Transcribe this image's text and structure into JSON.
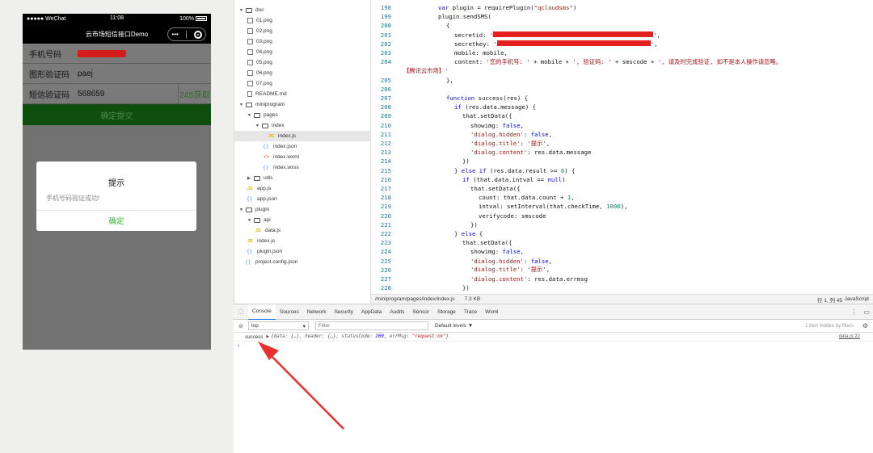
{
  "phone": {
    "carrier": "●●●●● WeChat",
    "time": "11:08",
    "battery": "100%",
    "nav_title": "云市场短信接口Demo",
    "capsule_more": "•••",
    "rows": [
      {
        "label": "手机号码",
        "value": ""
      },
      {
        "label": "图形验证码",
        "value": "paej"
      },
      {
        "label": "短信验证码",
        "value": "568659",
        "action": "24S获取"
      }
    ],
    "submit": "确定提交",
    "dialog": {
      "title": "提示",
      "content": "手机号码验证成功!",
      "confirm": "确定"
    }
  },
  "tree": {
    "items": [
      {
        "label": "doc",
        "kind": "folder",
        "open": true,
        "depth": 0
      },
      {
        "label": "01.png",
        "kind": "img",
        "depth": 1
      },
      {
        "label": "02.png",
        "kind": "img",
        "depth": 1
      },
      {
        "label": "03.png",
        "kind": "img",
        "depth": 1
      },
      {
        "label": "04.png",
        "kind": "img",
        "depth": 1
      },
      {
        "label": "05.png",
        "kind": "img",
        "depth": 1
      },
      {
        "label": "06.png",
        "kind": "img",
        "depth": 1
      },
      {
        "label": "07.png",
        "kind": "img",
        "depth": 1
      },
      {
        "label": "README.md",
        "kind": "doc",
        "depth": 1
      },
      {
        "label": "miniprogram",
        "kind": "folder",
        "open": true,
        "depth": 0
      },
      {
        "label": "pages",
        "kind": "folder",
        "open": true,
        "depth": 1
      },
      {
        "label": "index",
        "kind": "folder",
        "open": true,
        "depth": 2
      },
      {
        "label": "index.js",
        "kind": "js",
        "depth": 3,
        "selected": true
      },
      {
        "label": "index.json",
        "kind": "json",
        "depth": 3
      },
      {
        "label": "index.wxml",
        "kind": "xml",
        "depth": 3
      },
      {
        "label": "index.wxss",
        "kind": "css",
        "depth": 3
      },
      {
        "label": "utils",
        "kind": "folder",
        "open": false,
        "depth": 1
      },
      {
        "label": "app.js",
        "kind": "js",
        "depth": 1
      },
      {
        "label": "app.json",
        "kind": "json",
        "depth": 1
      },
      {
        "label": "plugin",
        "kind": "folder",
        "open": true,
        "depth": 0
      },
      {
        "label": "api",
        "kind": "folder",
        "open": true,
        "depth": 1
      },
      {
        "label": "data.js",
        "kind": "js",
        "depth": 2
      },
      {
        "label": "index.js",
        "kind": "js",
        "depth": 1
      },
      {
        "label": "plugin.json",
        "kind": "json",
        "depth": 1
      },
      {
        "label": "project.config.json",
        "kind": "json",
        "depth": 0
      }
    ]
  },
  "editor": {
    "lines": [
      {
        "n": "198",
        "indent": 5,
        "html": "<span class=\"kw\">var</span> plugin = requirePlugin(<span class=\"str\">\"qcloudsms\"</span>)"
      },
      {
        "n": "199",
        "indent": 5,
        "html": "plugin.sendSMS("
      },
      {
        "n": "200",
        "indent": 6,
        "html": "{"
      },
      {
        "n": "201",
        "indent": 7,
        "html": "secretid: <span class=\"str\">'</span><span class=\"redact\" style=\"width:198px\"></span><span class=\"str\">'</span>,"
      },
      {
        "n": "202",
        "indent": 7,
        "html": "secretkey: <span class=\"str\">'</span><span class=\"redact\" style=\"width:190px\"></span><span class=\"str\">'</span>,"
      },
      {
        "n": "203",
        "indent": 7,
        "html": "mobile: mobile,"
      },
      {
        "n": "204",
        "indent": 7,
        "html": "content: <span class=\"str\">'您的手机号: '</span> + mobile + <span class=\"str\">', 验证码: '</span> + smscode + <span class=\"str\">', 请及时完成验证, 如不是本人操作请忽略。</span>"
      },
      {
        "n": "",
        "indent": 0,
        "html": "<span class=\"str\">【腾讯云市场】'</span>"
      },
      {
        "n": "205",
        "indent": 6,
        "html": "},"
      },
      {
        "n": "206",
        "indent": 0,
        "html": ""
      },
      {
        "n": "207",
        "indent": 6,
        "html": "<span class=\"kw\">function</span> success(res) {"
      },
      {
        "n": "208",
        "indent": 7,
        "html": "<span class=\"kw\">if</span> (res.data.message) {"
      },
      {
        "n": "209",
        "indent": 8,
        "html": "that.setData({"
      },
      {
        "n": "210",
        "indent": 9,
        "html": "showimg: <span class=\"kw\">false</span>,"
      },
      {
        "n": "211",
        "indent": 9,
        "html": "<span class=\"str\">'dialog.hidden'</span>: <span class=\"kw\">false</span>,"
      },
      {
        "n": "212",
        "indent": 9,
        "html": "<span class=\"str\">'dialog.title'</span>: <span class=\"str\">'提示'</span>,"
      },
      {
        "n": "213",
        "indent": 9,
        "html": "<span class=\"str\">'dialog.content'</span>: res.data.message"
      },
      {
        "n": "214",
        "indent": 8,
        "html": "})"
      },
      {
        "n": "215",
        "indent": 7,
        "html": "} <span class=\"kw\">else if</span> (res.data.result >= <span class=\"num\">0</span>) {"
      },
      {
        "n": "216",
        "indent": 8,
        "html": "<span class=\"kw\">if</span> (that.data.intval == <span class=\"kw\">null</span>)"
      },
      {
        "n": "217",
        "indent": 9,
        "html": "that.setData({"
      },
      {
        "n": "218",
        "indent": 10,
        "html": "count: that.data.count + <span class=\"num\">1</span>,"
      },
      {
        "n": "219",
        "indent": 10,
        "html": "intval: setInterval(that.checkTime, <span class=\"num\">1000</span>),"
      },
      {
        "n": "220",
        "indent": 10,
        "html": "verifycode: smscode"
      },
      {
        "n": "221",
        "indent": 9,
        "html": "})"
      },
      {
        "n": "222",
        "indent": 7,
        "html": "} <span class=\"kw\">else</span> {"
      },
      {
        "n": "223",
        "indent": 8,
        "html": "that.setData({"
      },
      {
        "n": "224",
        "indent": 9,
        "html": "showimg: <span class=\"kw\">false</span>,"
      },
      {
        "n": "225",
        "indent": 9,
        "html": "<span class=\"str\">'dialog.hidden'</span>: <span class=\"kw\">false</span>,"
      },
      {
        "n": "226",
        "indent": 9,
        "html": "<span class=\"str\">'dialog.title'</span>: <span class=\"str\">'提示'</span>,"
      },
      {
        "n": "227",
        "indent": 9,
        "html": "<span class=\"str\">'dialog.content'</span>: res.data.errmsg"
      },
      {
        "n": "228",
        "indent": 8,
        "html": "})"
      }
    ],
    "status": {
      "path": "/miniprogram/pages/index/index.js",
      "size": "7.3 KB",
      "position": "行 1, 列 45",
      "language": "JavaScript"
    }
  },
  "devtools": {
    "tabs": [
      "Console",
      "Sources",
      "Network",
      "Security",
      "AppData",
      "Audits",
      "Sensor",
      "Storage",
      "Trace",
      "Wxml"
    ],
    "active_tab": "Console",
    "context": "top",
    "filter_placeholder": "Filter",
    "levels": "Default levels ▼",
    "hidden_info": "1 item hidden by filters",
    "log": {
      "label": "success",
      "source": "data.js:22"
    },
    "prompt": "›"
  },
  "colors": {
    "accent_green": "#3cb035",
    "annotation_arrow": "#e8312f",
    "redaction": "#e31f1f"
  }
}
